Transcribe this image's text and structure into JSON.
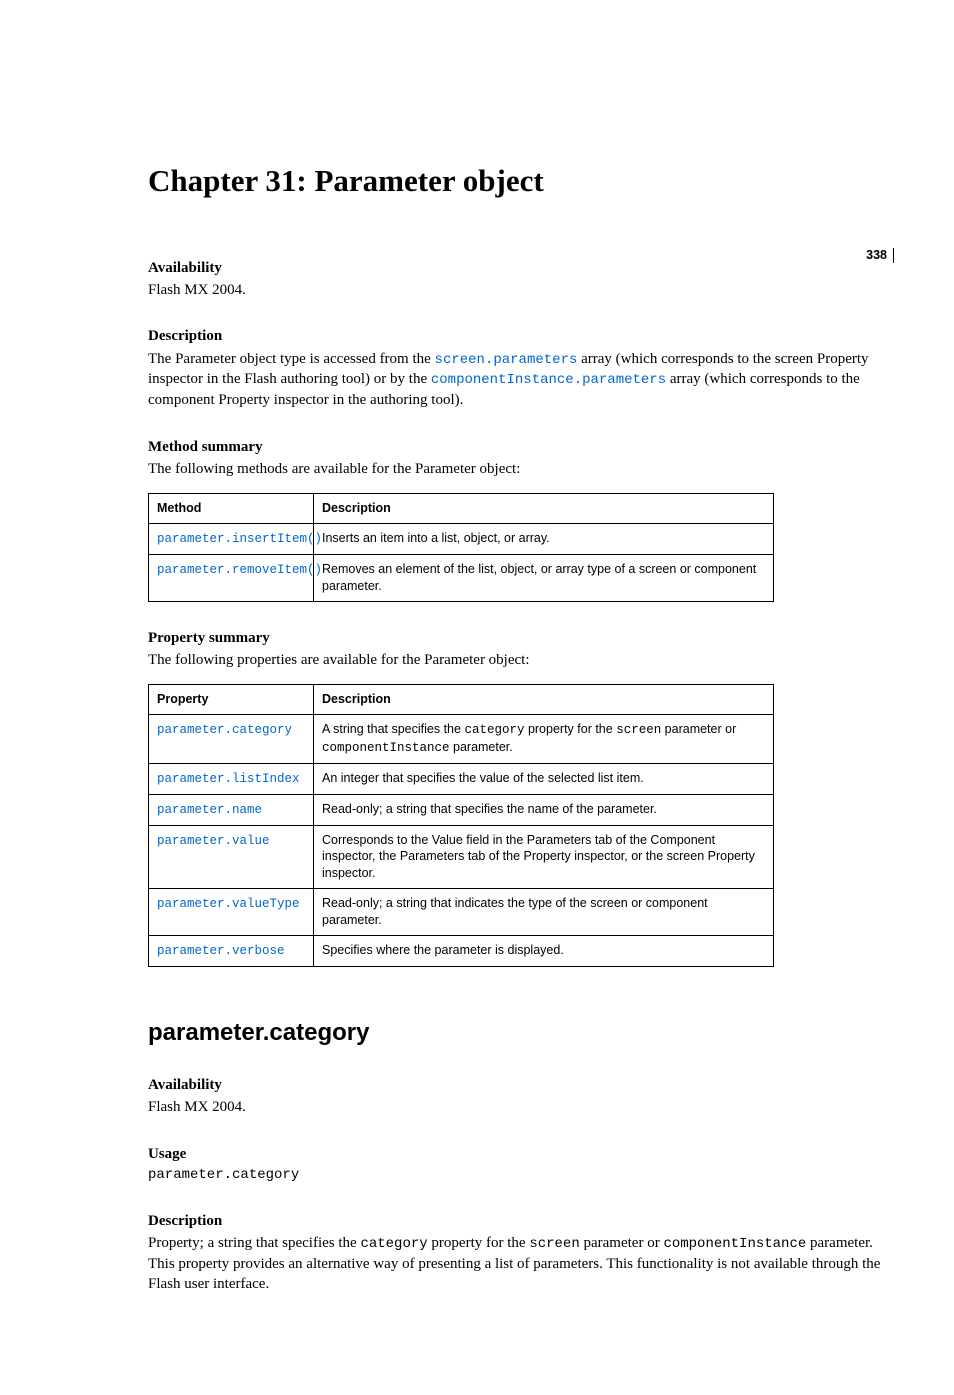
{
  "pageNumber": "338",
  "chapterTitle": "Chapter 31: Parameter object",
  "s1": {
    "availLabel": "Availability",
    "availText": "Flash MX 2004.",
    "descLabel": "Description",
    "desc_pre": "The Parameter object type is accessed from the ",
    "desc_link1": "screen.parameters",
    "desc_mid1": " array (which corresponds to the screen Property inspector in the Flash authoring tool) or by the ",
    "desc_link2": "componentInstance.parameters",
    "desc_mid2": " array (which corresponds to the component Property inspector in the authoring tool).",
    "methodSummaryLabel": "Method summary",
    "methodSummaryIntro": "The following methods are available for the Parameter object:",
    "methodTable": {
      "h1": "Method",
      "h2": "Description",
      "rows": [
        {
          "m": "parameter.insertItem()",
          "d": "Inserts an item into a list, object, or array."
        },
        {
          "m": "parameter.removeItem()",
          "d": "Removes an element of the list, object, or array type of a screen or component parameter."
        }
      ]
    },
    "propSummaryLabel": "Property summary",
    "propSummaryIntro": "The following properties are available for the Parameter object:",
    "propTable": {
      "h1": "Property",
      "h2": "Description",
      "rows": [
        {
          "p": "parameter.category",
          "d_pre": "A string that specifies the ",
          "d_c1": "category",
          "d_mid1": " property for the ",
          "d_c2": "screen",
          "d_mid2": " parameter or ",
          "d_c3": "componentInstance",
          "d_post": " parameter."
        },
        {
          "p": "parameter.listIndex",
          "d": "An integer that specifies the value of the selected list item."
        },
        {
          "p": "parameter.name",
          "d": "Read-only; a string that specifies the name of the parameter."
        },
        {
          "p": "parameter.value",
          "d": "Corresponds to the Value field in the Parameters tab of the Component inspector, the Parameters tab of the Property inspector, or the screen Property inspector."
        },
        {
          "p": "parameter.valueType",
          "d": "Read-only; a string that indicates the type of the screen or component parameter."
        },
        {
          "p": "parameter.verbose",
          "d": "Specifies where the parameter is displayed."
        }
      ]
    }
  },
  "s2": {
    "title": "parameter.category",
    "availLabel": "Availability",
    "availText": "Flash MX 2004.",
    "usageLabel": "Usage",
    "usageText": "parameter.category",
    "descLabel": "Description",
    "desc_pre": "Property; a string that specifies the ",
    "desc_c1": "category",
    "desc_mid1": " property for the ",
    "desc_c2": "screen",
    "desc_mid2": " parameter or ",
    "desc_c3": "componentInstance",
    "desc_post": " parameter. This property provides an alternative way of presenting a list of parameters. This functionality is not available through the Flash user interface."
  }
}
